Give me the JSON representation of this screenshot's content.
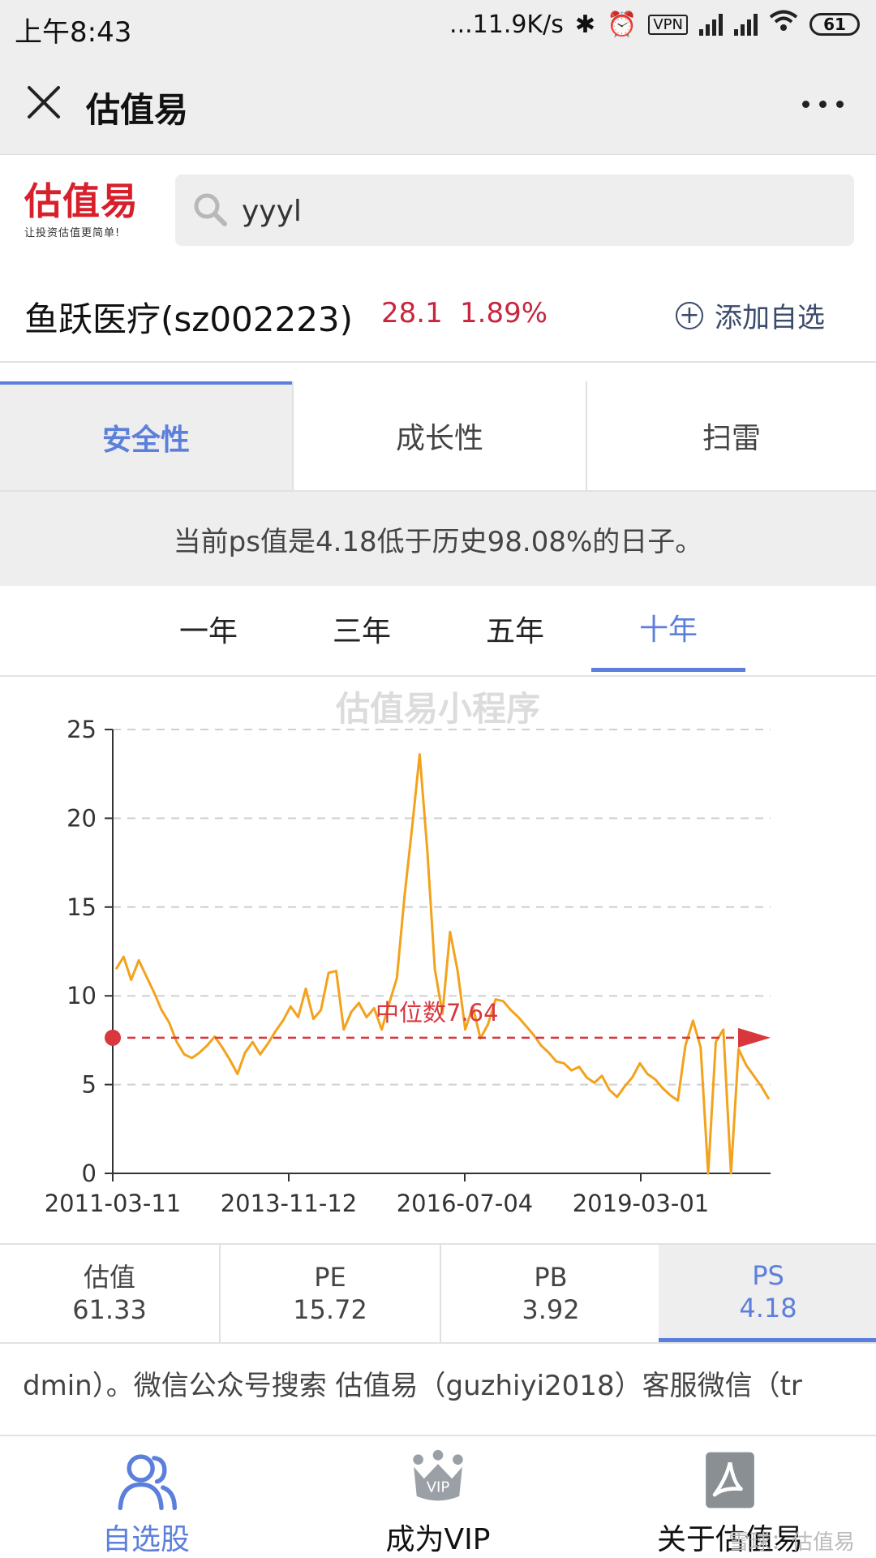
{
  "status_bar": {
    "time": "上午8:43",
    "network_speed": "...11.9K/s",
    "vpn": "VPN",
    "battery": "61"
  },
  "title_bar": {
    "title": "估值易"
  },
  "brand": {
    "logo_text": "估值易",
    "slogan": "让投资估值更简单!"
  },
  "search": {
    "value": "yyyl"
  },
  "stock": {
    "name": "鱼跃医疗(sz002223)",
    "price": "28.1",
    "change": "1.89%",
    "add_label": "添加自选"
  },
  "main_tabs": [
    {
      "label": "安全性",
      "active": true
    },
    {
      "label": "成长性",
      "active": false
    },
    {
      "label": "扫雷",
      "active": false
    }
  ],
  "info_banner": "当前ps值是4.18低于历史98.08%的日子。",
  "periods": [
    {
      "label": "一年",
      "active": false
    },
    {
      "label": "三年",
      "active": false
    },
    {
      "label": "五年",
      "active": false
    },
    {
      "label": "十年",
      "active": true
    }
  ],
  "chart_watermark": "估值易小程序",
  "chart_data": {
    "type": "line",
    "title": "",
    "xlabel": "",
    "ylabel": "",
    "ylim": [
      0,
      25
    ],
    "yticks": [
      "0",
      "5",
      "10",
      "15",
      "20",
      "25"
    ],
    "xticks": [
      "2011-03-11",
      "2013-11-12",
      "2016-07-04",
      "2019-03-01"
    ],
    "grid": "horizontal dashed",
    "series_color": "#f3a21c",
    "median_color": "#d8373e",
    "median_label": "中位数7.64",
    "median_value": 7.64,
    "series": [
      {
        "values": [
          11.5,
          12.2,
          10.9,
          12.0,
          11.1,
          10.2,
          9.2,
          8.5,
          7.4,
          6.7,
          6.5,
          6.8,
          7.2,
          7.7,
          7.1,
          6.4,
          5.6,
          6.8,
          7.4,
          6.7,
          7.3,
          8.0,
          8.6,
          9.4,
          8.8,
          10.4,
          8.7,
          9.2,
          11.3,
          11.4,
          8.1,
          9.1,
          9.6,
          8.8,
          9.3,
          8.1,
          9.6,
          11.0,
          15.6,
          19.5,
          23.6,
          18.2,
          11.5,
          9.0,
          13.6,
          11.4,
          8.1,
          9.4,
          7.6,
          8.4,
          9.8,
          9.7,
          9.2,
          8.8,
          8.3,
          7.8,
          7.2,
          6.8,
          6.3,
          6.2,
          5.8,
          6.0,
          5.4,
          5.1,
          5.5,
          4.7,
          4.3,
          4.9,
          5.4,
          6.2,
          5.6,
          5.3,
          4.8,
          4.4,
          4.1,
          7.2,
          8.6,
          7.1,
          0.0,
          7.4,
          8.1,
          0.0,
          7.0,
          6.1,
          5.5,
          4.9,
          4.18
        ]
      }
    ]
  },
  "metrics": [
    {
      "label": "估值",
      "value": "61.33",
      "active": false
    },
    {
      "label": "PE",
      "value": "15.72",
      "active": false
    },
    {
      "label": "PB",
      "value": "3.92",
      "active": false
    },
    {
      "label": "PS",
      "value": "4.18",
      "active": true
    }
  ],
  "notice_text": "dmin）。微信公众号搜索 估值易（guzhiyi2018）客服微信（tr",
  "bottom_nav": [
    {
      "label": "自选股",
      "active": true
    },
    {
      "label": "成为VIP",
      "active": false,
      "badge": "VIP"
    },
    {
      "label": "关于估值易",
      "active": false
    }
  ],
  "footer_watermark": "雪球：估值易"
}
